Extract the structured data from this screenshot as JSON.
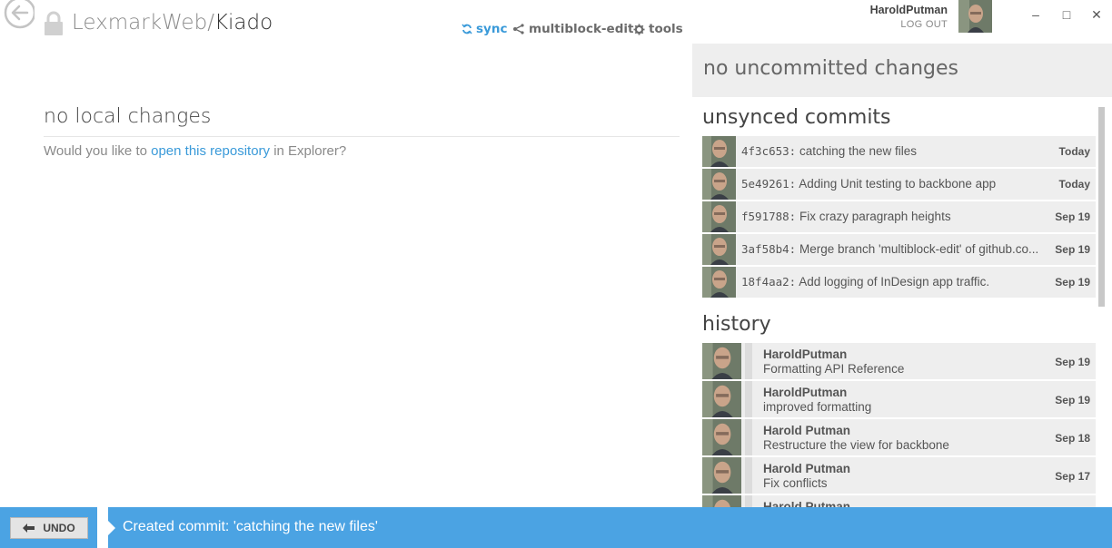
{
  "header": {
    "repo_owner": "LexmarkWeb",
    "repo_separator": "/",
    "repo_name": "Kiado",
    "icons": {
      "back": "back-arrow-icon",
      "lock": "lock-icon"
    }
  },
  "toolbar": {
    "sync_label": "sync",
    "branch_label": "multiblock-edit",
    "tools_label": "tools"
  },
  "user": {
    "name": "HaroldPutman",
    "logout_label": "LOG OUT"
  },
  "window": {
    "minimize": "–",
    "maximize": "□",
    "close": "✕"
  },
  "main": {
    "heading": "no local changes",
    "message_prefix": "Would you like to ",
    "message_link": "open this repository",
    "message_suffix": " in Explorer?"
  },
  "changes_panel": {
    "uncommitted_label": "no uncommitted changes",
    "unsynced_heading": "unsynced commits",
    "unsynced_commits": [
      {
        "sha": "4f3c653:",
        "message": "catching the new files",
        "date": "Today"
      },
      {
        "sha": "5e49261:",
        "message": "Adding Unit testing to backbone app",
        "date": "Today"
      },
      {
        "sha": "f591788:",
        "message": "Fix crazy paragraph heights",
        "date": "Sep 19"
      },
      {
        "sha": "3af58b4:",
        "message": "Merge branch 'multiblock-edit' of github.co...",
        "date": "Sep 19"
      },
      {
        "sha": "18f4aa2:",
        "message": "Add logging of InDesign app traffic.",
        "date": "Sep 19"
      }
    ],
    "history_heading": "history",
    "history": [
      {
        "author": "HaroldPutman",
        "message": "Formatting API Reference",
        "date": "Sep 19"
      },
      {
        "author": "HaroldPutman",
        "message": "improved formatting",
        "date": "Sep 19"
      },
      {
        "author": "Harold Putman",
        "message": "Restructure the view for backbone",
        "date": "Sep 18"
      },
      {
        "author": "Harold Putman",
        "message": "Fix conflicts",
        "date": "Sep 17"
      },
      {
        "author": "Harold Putman",
        "message": "",
        "date": ""
      }
    ]
  },
  "notification": {
    "undo_label": "UNDO",
    "message": "Created commit: 'catching the new files'",
    "accent_color": "#4ba3e3"
  }
}
